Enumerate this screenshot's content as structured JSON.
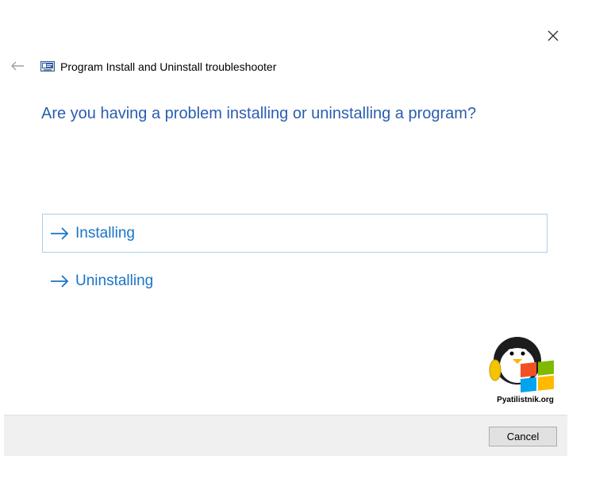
{
  "window": {
    "title": "Program Install and Uninstall troubleshooter",
    "back_icon": "back-arrow-icon",
    "close_icon": "close-icon",
    "app_icon": "troubleshooter-icon"
  },
  "main": {
    "question": "Are you having a problem installing or uninstalling a program?",
    "options": [
      {
        "label": "Installing",
        "icon": "right-arrow-icon",
        "selected": true
      },
      {
        "label": "Uninstalling",
        "icon": "right-arrow-icon",
        "selected": false
      }
    ]
  },
  "watermark": {
    "text": "Pyatilistnik.org"
  },
  "footer": {
    "cancel_label": "Cancel"
  },
  "colors": {
    "question": "#2b5eb0",
    "option_text": "#1a74c8",
    "selected_border": "#a8cfee",
    "footer_bg": "#f0f0f0"
  }
}
